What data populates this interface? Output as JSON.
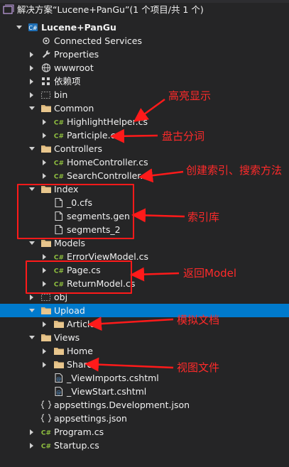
{
  "solution_header": "解决方案“Lucene+PanGu”(1 个项目/共 1 个)",
  "tree": [
    {
      "label": "Lucene+PanGu",
      "icon": "csharp-project-icon",
      "indent": 0,
      "arrow": "open",
      "bold": true
    },
    {
      "label": "Connected Services",
      "icon": "connected-services-icon",
      "indent": 1,
      "arrow": "none"
    },
    {
      "label": "Properties",
      "icon": "wrench-icon",
      "indent": 1,
      "arrow": "closed"
    },
    {
      "label": "wwwroot",
      "icon": "globe-icon",
      "indent": 1,
      "arrow": "closed"
    },
    {
      "label": "依赖项",
      "icon": "dependencies-icon",
      "indent": 1,
      "arrow": "closed"
    },
    {
      "label": "bin",
      "icon": "dashed-folder-icon",
      "indent": 1,
      "arrow": "closed"
    },
    {
      "label": "Common",
      "icon": "folder-icon",
      "indent": 1,
      "arrow": "open"
    },
    {
      "label": "HighlightHelper.cs",
      "icon": "csharp-file-icon",
      "indent": 2,
      "arrow": "closed"
    },
    {
      "label": "Participle.cs",
      "icon": "csharp-file-icon",
      "indent": 2,
      "arrow": "closed"
    },
    {
      "label": "Controllers",
      "icon": "folder-icon",
      "indent": 1,
      "arrow": "open"
    },
    {
      "label": "HomeController.cs",
      "icon": "csharp-file-icon",
      "indent": 2,
      "arrow": "closed"
    },
    {
      "label": "SearchController.cs",
      "icon": "csharp-file-icon",
      "indent": 2,
      "arrow": "closed"
    },
    {
      "label": "Index",
      "icon": "folder-icon",
      "indent": 1,
      "arrow": "open"
    },
    {
      "label": "_0.cfs",
      "icon": "file-icon",
      "indent": 2,
      "arrow": "none"
    },
    {
      "label": "segments.gen",
      "icon": "file-icon",
      "indent": 2,
      "arrow": "none"
    },
    {
      "label": "segments_2",
      "icon": "file-icon",
      "indent": 2,
      "arrow": "none"
    },
    {
      "label": "Models",
      "icon": "folder-icon",
      "indent": 1,
      "arrow": "open"
    },
    {
      "label": "ErrorViewModel.cs",
      "icon": "csharp-file-icon",
      "indent": 2,
      "arrow": "closed"
    },
    {
      "label": "Page.cs",
      "icon": "csharp-file-icon",
      "indent": 2,
      "arrow": "closed"
    },
    {
      "label": "ReturnModel.cs",
      "icon": "csharp-file-icon",
      "indent": 2,
      "arrow": "closed"
    },
    {
      "label": "obj",
      "icon": "dashed-folder-icon",
      "indent": 1,
      "arrow": "closed"
    },
    {
      "label": "Upload",
      "icon": "folder-icon",
      "indent": 1,
      "arrow": "open",
      "selected": true
    },
    {
      "label": "Articles",
      "icon": "folder-icon",
      "indent": 2,
      "arrow": "closed"
    },
    {
      "label": "Views",
      "icon": "folder-icon",
      "indent": 1,
      "arrow": "open"
    },
    {
      "label": "Home",
      "icon": "folder-icon",
      "indent": 2,
      "arrow": "closed"
    },
    {
      "label": "Shared",
      "icon": "folder-icon",
      "indent": 2,
      "arrow": "closed"
    },
    {
      "label": "_ViewImports.cshtml",
      "icon": "razor-file-icon",
      "indent": 2,
      "arrow": "none"
    },
    {
      "label": "_ViewStart.cshtml",
      "icon": "razor-file-icon",
      "indent": 2,
      "arrow": "none"
    },
    {
      "label": "appsettings.Development.json",
      "icon": "json-file-icon",
      "indent": 1,
      "arrow": "none"
    },
    {
      "label": "appsettings.json",
      "icon": "json-file-icon",
      "indent": 1,
      "arrow": "none"
    },
    {
      "label": "Program.cs",
      "icon": "csharp-file-icon",
      "indent": 1,
      "arrow": "closed"
    },
    {
      "label": "Startup.cs",
      "icon": "csharp-file-icon",
      "indent": 1,
      "arrow": "closed"
    }
  ],
  "annotations": {
    "highlight": "高亮显示",
    "participle": "盘古分词",
    "search": "创建索引、搜索方法",
    "index_lib": "索引库",
    "return_model": "返回Model",
    "mock_docs": "模拟文档",
    "view_files": "视图文件"
  },
  "colors": {
    "background": "#252526",
    "selected": "#007acc",
    "annotation": "#ff2a2a",
    "folder": "#dcb67a",
    "csharp": "#8fbf3f"
  }
}
